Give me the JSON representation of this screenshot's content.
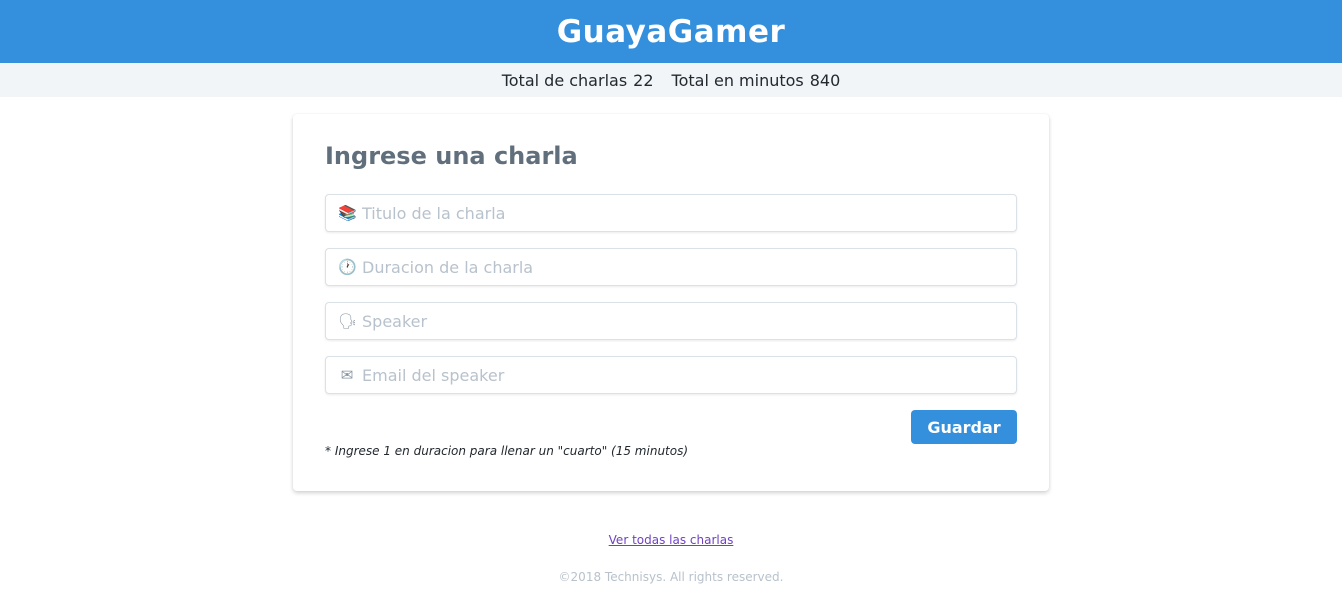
{
  "header": {
    "title": "GuayaGamer"
  },
  "stats": {
    "talks_label": "Total de charlas",
    "talks_value": "22",
    "minutes_label": "Total en minutos",
    "minutes_value": "840"
  },
  "form": {
    "heading": "Ingrese una charla",
    "fields": [
      {
        "icon": "books-icon",
        "glyph": "📚",
        "placeholder": "Titulo de la charla",
        "value": ""
      },
      {
        "icon": "clock-icon",
        "glyph": "🕐",
        "placeholder": "Duracion de la charla",
        "value": ""
      },
      {
        "icon": "speaking-head-icon",
        "glyph": "🗣",
        "placeholder": "Speaker",
        "value": ""
      },
      {
        "icon": "envelope-icon",
        "glyph": "✉",
        "placeholder": "Email del speaker",
        "value": ""
      }
    ],
    "submit_label": "Guardar",
    "note": "* Ingrese 1 en duracion para llenar un \"cuarto\" (15 minutos)"
  },
  "footer": {
    "link_label": "Ver todas las charlas",
    "copyright": "©2018 Technisys. All rights reserved."
  },
  "colors": {
    "accent": "#3490dc",
    "stats_bg": "#f1f5f8",
    "heading": "#606f7b",
    "link": "#6f42c1"
  }
}
